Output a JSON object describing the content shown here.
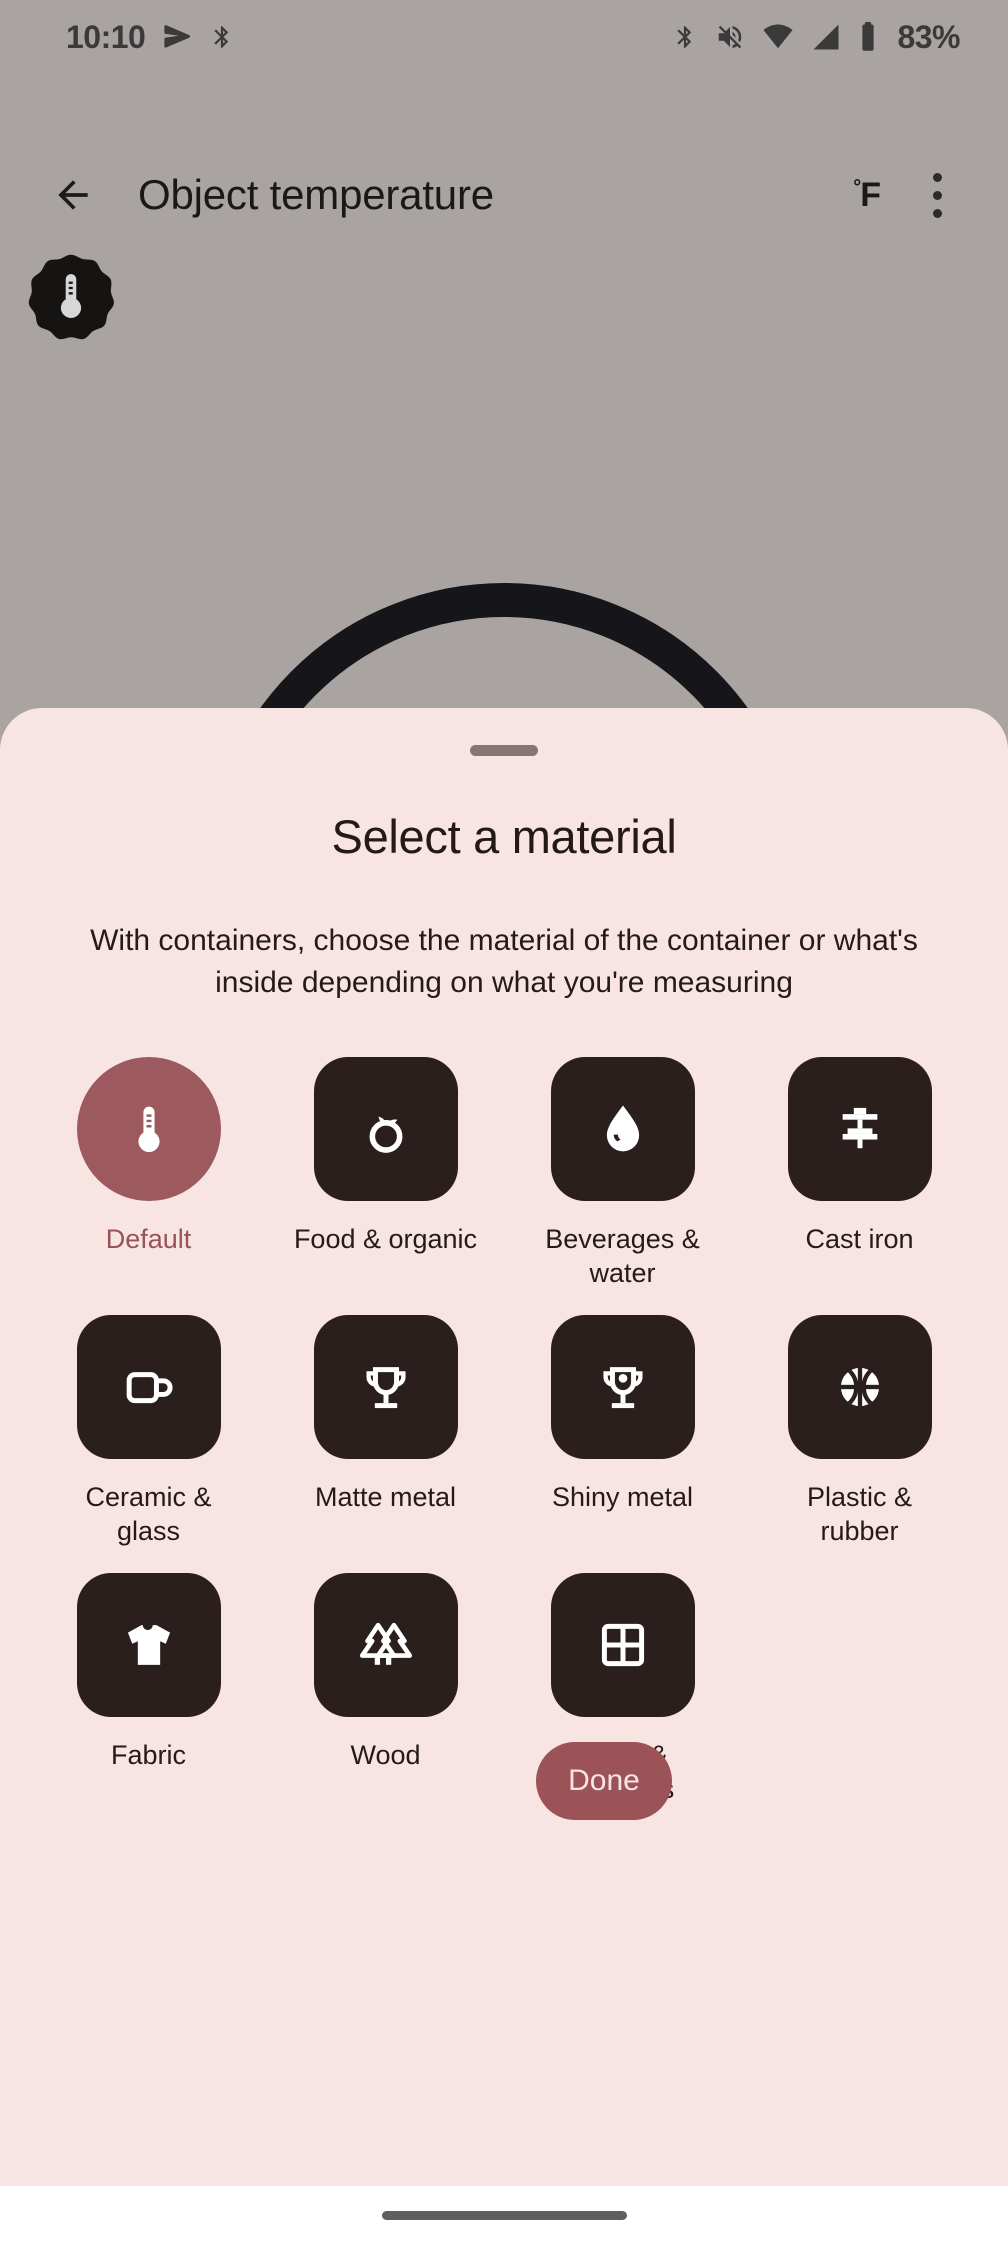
{
  "status_bar": {
    "time": "10:10",
    "battery_percent": "83%",
    "left_icons": [
      "navigation-send-icon",
      "bluetooth-icon"
    ],
    "right_icons": [
      "bluetooth-icon",
      "ringer-vibrate-off-icon",
      "wifi-icon",
      "cellular-signal-icon",
      "battery-icon"
    ]
  },
  "app_bar": {
    "back_icon": "back-arrow-icon",
    "title": "Object temperature",
    "unit_degree": "°",
    "unit_letter": "F",
    "overflow_icon": "more-vertical-icon"
  },
  "viewfinder": {
    "badge_icon": "thermometer-icon"
  },
  "sheet": {
    "title": "Select a material",
    "subtitle": "With containers, choose the material of the container or what's inside depending on what you're measuring",
    "done_label": "Done",
    "materials": [
      {
        "label": "Default",
        "icon": "thermometer-icon",
        "selected": true
      },
      {
        "label": "Food & organic",
        "icon": "apple-outline-icon",
        "selected": false
      },
      {
        "label": "Beverages & water",
        "icon": "water-drop-icon",
        "selected": false
      },
      {
        "label": "Cast iron",
        "icon": "skillet-icon",
        "selected": false
      },
      {
        "label": "Ceramic & glass",
        "icon": "mug-icon",
        "selected": false
      },
      {
        "label": "Matte metal",
        "icon": "trophy-icon",
        "selected": false
      },
      {
        "label": "Shiny metal",
        "icon": "trophy-shine-icon",
        "selected": false
      },
      {
        "label": "Plastic & rubber",
        "icon": "basketball-icon",
        "selected": false
      },
      {
        "label": "Fabric",
        "icon": "tshirt-icon",
        "selected": false
      },
      {
        "label": "Wood",
        "icon": "pine-trees-icon",
        "selected": false
      },
      {
        "label": "Walls & windows",
        "icon": "window-grid-icon",
        "selected": false
      }
    ]
  },
  "nav_bar": {
    "gesture_pill": "home-gesture-pill"
  },
  "colors": {
    "sheet_background": "#f8e4e3",
    "tile_dark": "#2b1f1d",
    "accent_rose": "#9c5a5f",
    "done_button": "#9c5358",
    "backdrop": "#a9a4a2"
  }
}
